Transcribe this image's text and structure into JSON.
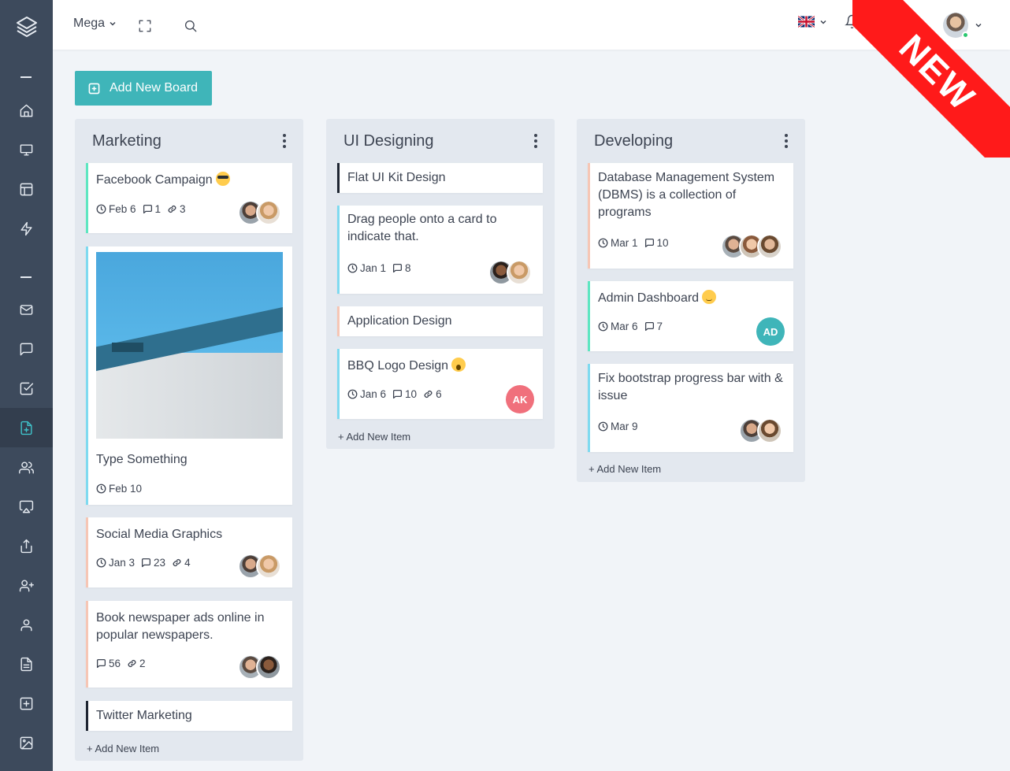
{
  "topbar": {
    "menu_label": "Mega"
  },
  "ribbon": {
    "label": "NEW"
  },
  "actions": {
    "add_board_label": "Add New Board"
  },
  "colors": {
    "accent": "#3fb5b9",
    "sidebar": "#3d4a5c",
    "ribbon": "#ff1a1a"
  },
  "columns": [
    {
      "title": "Marketing",
      "add_item_label": "+ Add New Item",
      "cards": [
        {
          "title": "Facebook Campaign",
          "emoji": "sunglasses-emoji",
          "date": "Feb 6",
          "comments": "1",
          "links": "3"
        },
        {
          "title": "Type Something",
          "date": "Feb 10"
        },
        {
          "title": "Social Media Graphics",
          "date": "Jan 3",
          "comments": "23",
          "links": "4"
        },
        {
          "title": "Book newspaper ads online in popular newspapers.",
          "comments": "56",
          "links": "2"
        },
        {
          "title": "Twitter Marketing"
        }
      ]
    },
    {
      "title": "UI Designing",
      "add_item_label": "+ Add New Item",
      "cards": [
        {
          "title": "Flat UI Kit Design"
        },
        {
          "title": "Drag people onto a card to indicate that.",
          "date": "Jan 1",
          "comments": "8"
        },
        {
          "title": "Application Design"
        },
        {
          "title": "BBQ Logo Design",
          "emoji": "scream-emoji",
          "date": "Jan 6",
          "comments": "10",
          "links": "6",
          "initials": "AK"
        }
      ]
    },
    {
      "title": "Developing",
      "add_item_label": "+ Add New Item",
      "cards": [
        {
          "title": "Database Management System (DBMS) is a collection of programs",
          "date": "Mar 1",
          "comments": "10"
        },
        {
          "title": "Admin Dashboard",
          "emoji": "slight-smile-emoji",
          "date": "Mar 6",
          "comments": "7",
          "initials": "AD"
        },
        {
          "title": "Fix bootstrap progress bar with & issue",
          "date": "Mar 9"
        }
      ]
    }
  ]
}
